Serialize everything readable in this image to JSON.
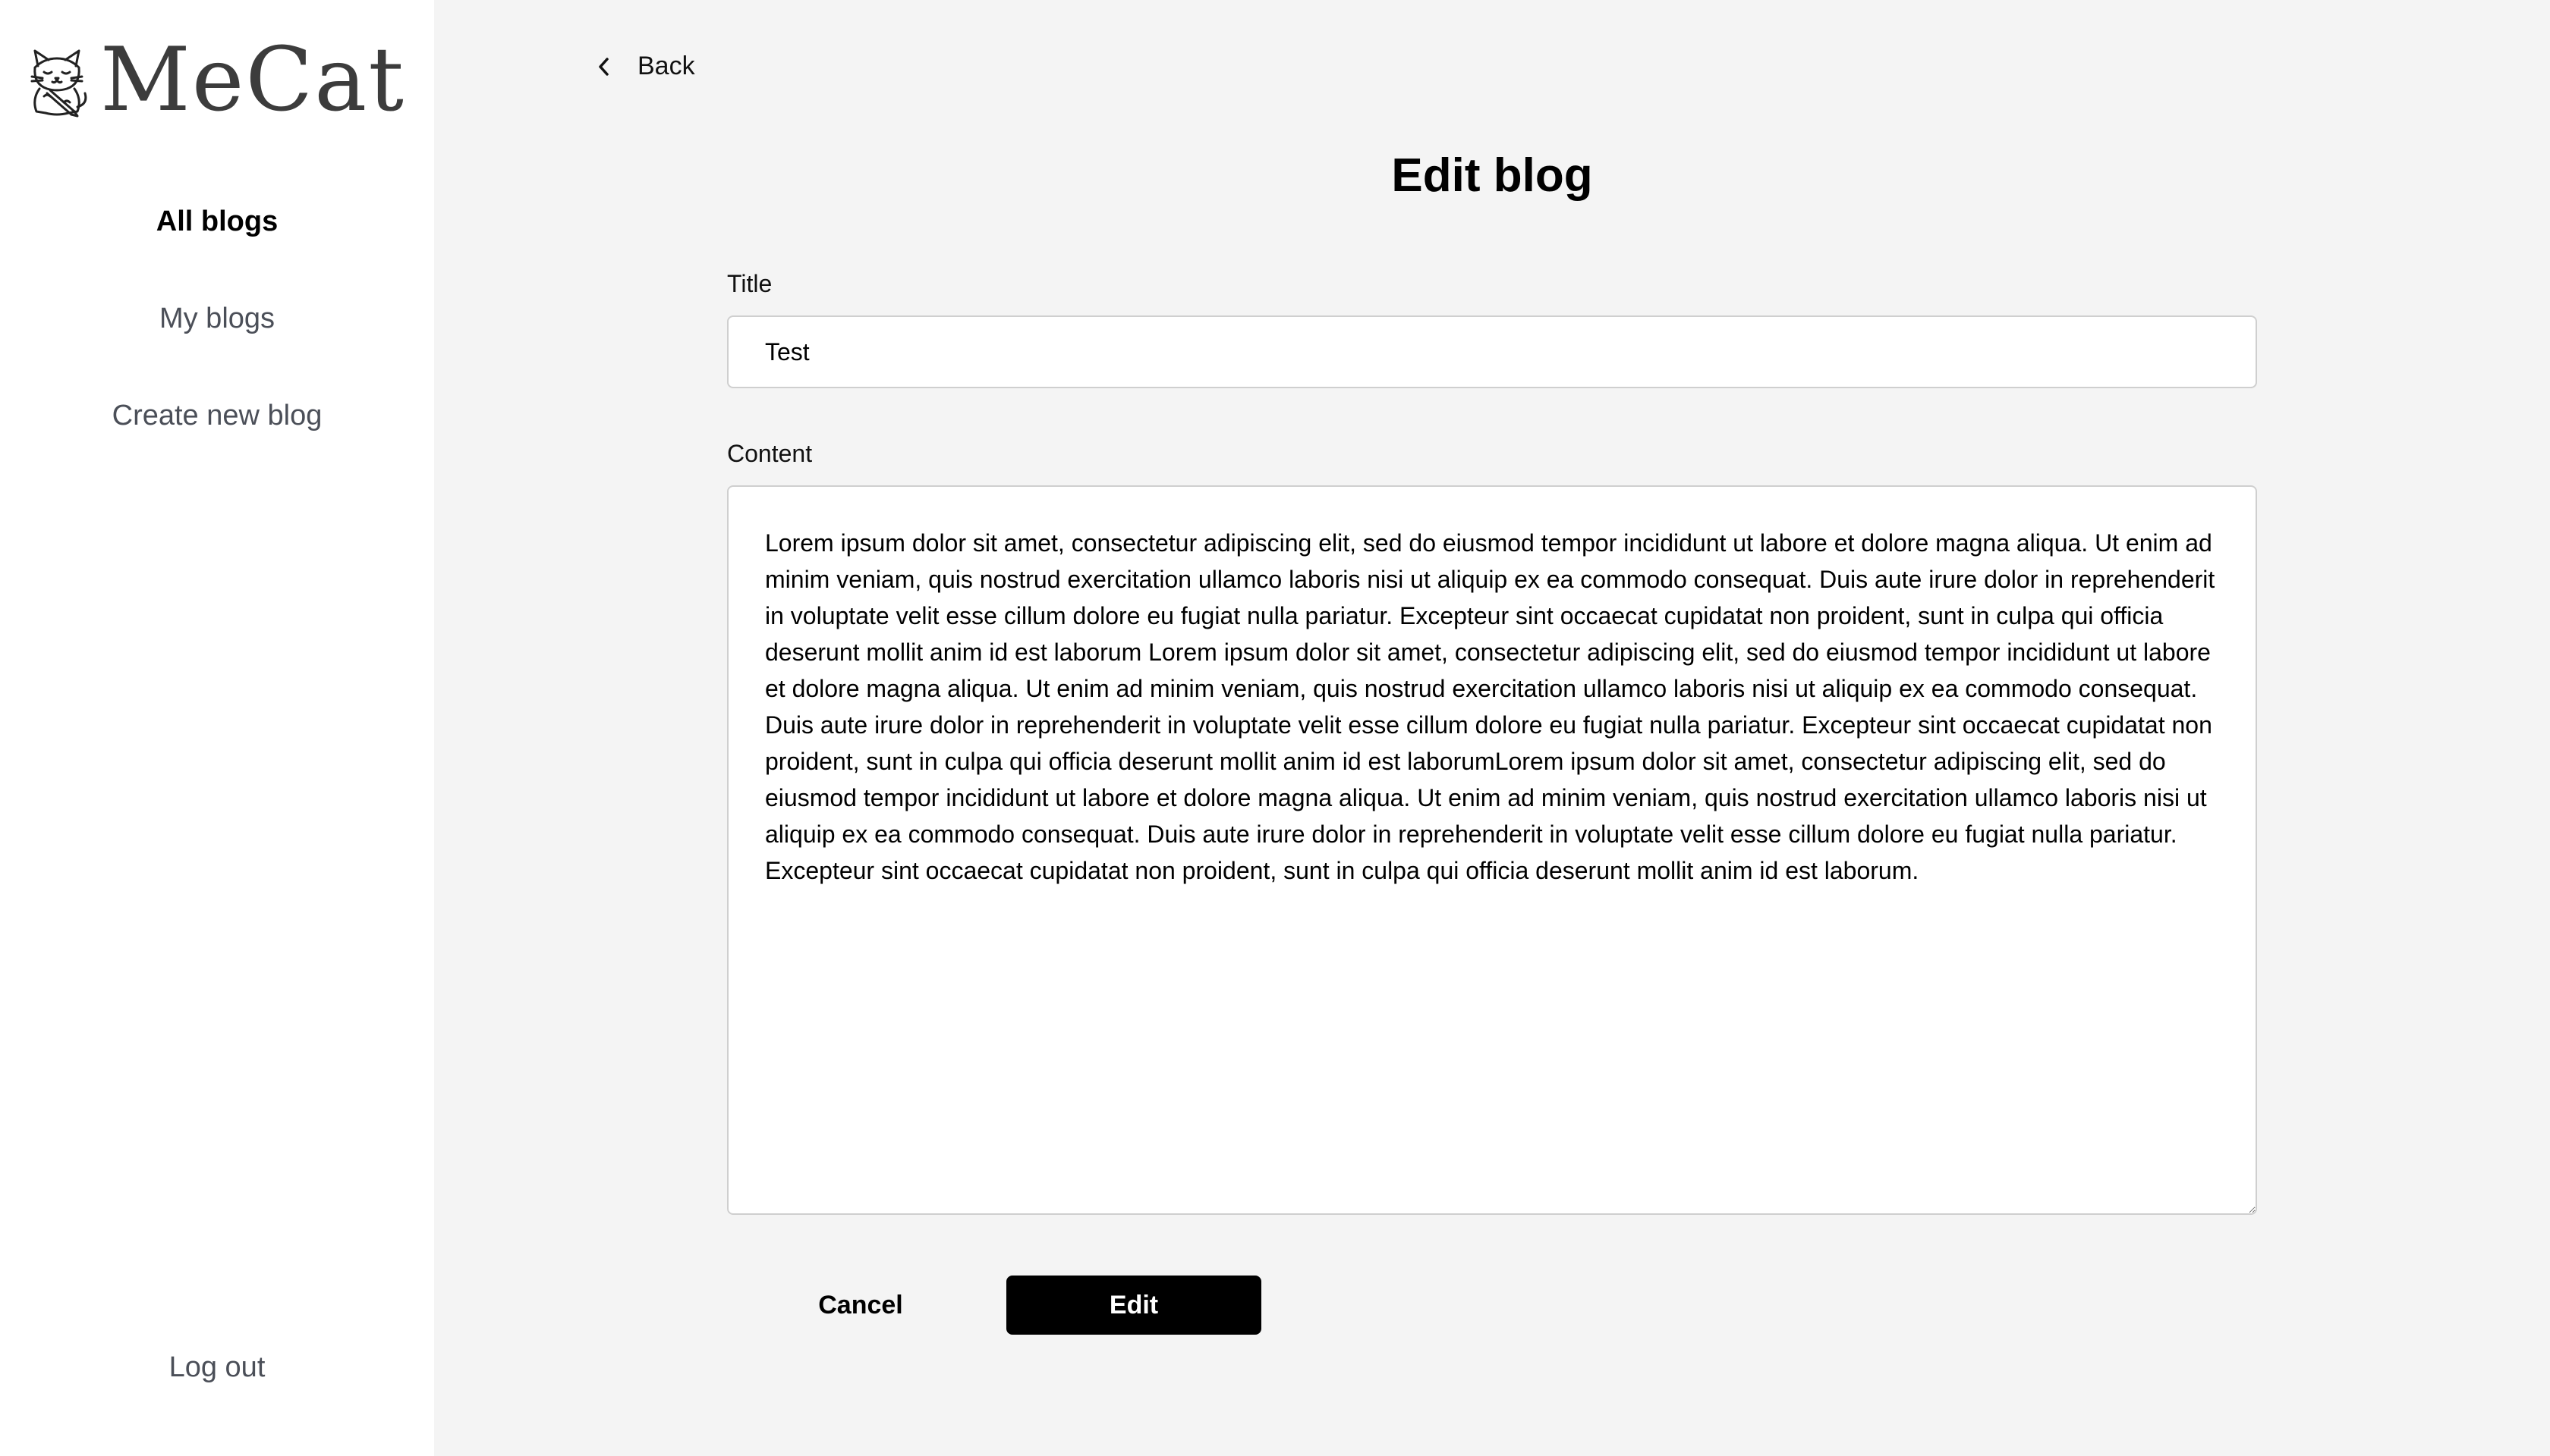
{
  "sidebar": {
    "logo_text": "MeCat",
    "logo_icon": "cat-icon",
    "nav_items": [
      {
        "label": "All blogs",
        "active": true
      },
      {
        "label": "My blogs",
        "active": false
      },
      {
        "label": "Create new blog",
        "active": false
      }
    ],
    "logout_label": "Log out"
  },
  "main": {
    "back_label": "Back",
    "back_icon": "chevron-left-icon",
    "page_title": "Edit blog",
    "form": {
      "title_label": "Title",
      "title_value": "Test",
      "content_label": "Content",
      "content_value": "Lorem ipsum dolor sit amet, consectetur adipiscing elit, sed do eiusmod tempor incididunt ut labore et dolore magna aliqua. Ut enim ad minim veniam, quis nostrud exercitation ullamco laboris nisi ut aliquip ex ea commodo consequat. Duis aute irure dolor in reprehenderit in voluptate velit esse cillum dolore eu fugiat nulla pariatur. Excepteur sint occaecat cupidatat non proident, sunt in culpa qui officia deserunt mollit anim id est laborum Lorem ipsum dolor sit amet, consectetur adipiscing elit, sed do eiusmod tempor incididunt ut labore et dolore magna aliqua. Ut enim ad minim veniam, quis nostrud exercitation ullamco laboris nisi ut aliquip ex ea commodo consequat. Duis aute irure dolor in reprehenderit in voluptate velit esse cillum dolore eu fugiat nulla pariatur. Excepteur sint occaecat cupidatat non proident, sunt in culpa qui officia deserunt mollit anim id est laborumLorem ipsum dolor sit amet, consectetur adipiscing elit, sed do eiusmod tempor incididunt ut labore et dolore magna aliqua. Ut enim ad minim veniam, quis nostrud exercitation ullamco laboris nisi ut aliquip ex ea commodo consequat. Duis aute irure dolor in reprehenderit in voluptate velit esse cillum dolore eu fugiat nulla pariatur. Excepteur sint occaecat cupidatat non proident, sunt in culpa qui officia deserunt mollit anim id est laborum."
    },
    "cancel_label": "Cancel",
    "submit_label": "Edit"
  },
  "colors": {
    "sidebar_bg": "#ffffff",
    "main_bg": "#f4f4f4",
    "primary_button": "#000000",
    "nav_text": "#4b4f58"
  }
}
